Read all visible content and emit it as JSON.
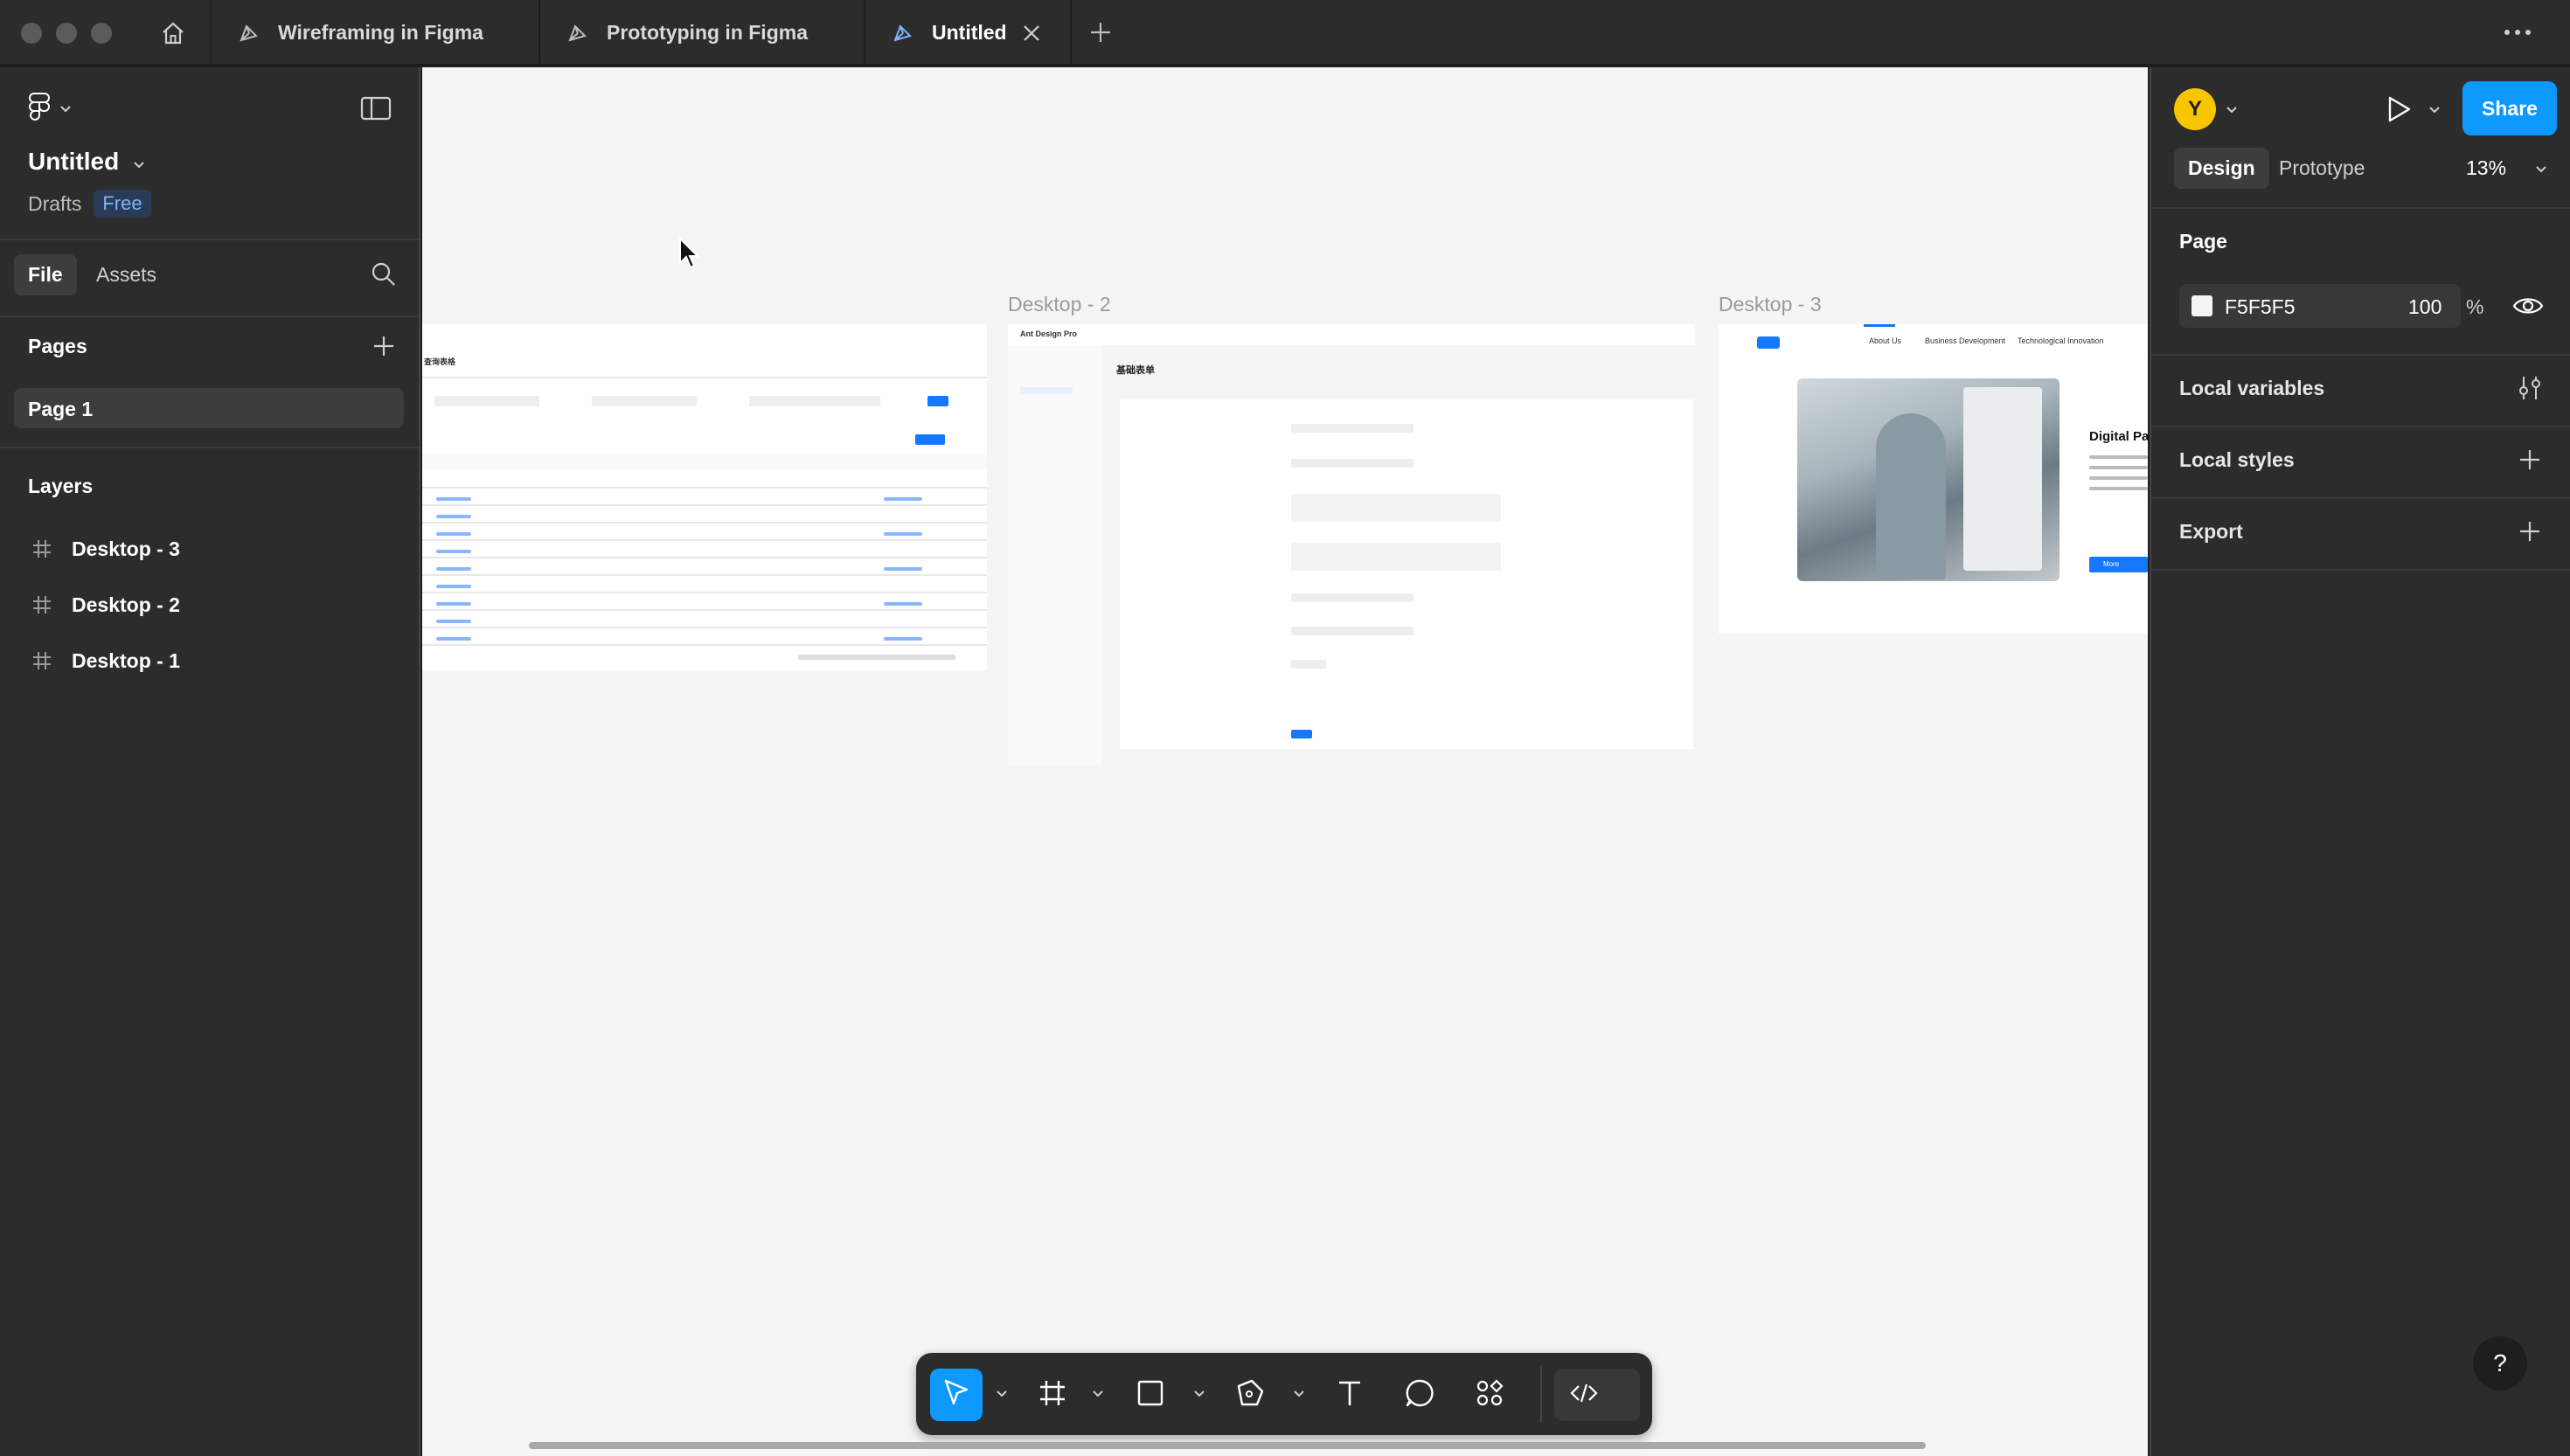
{
  "tabs": [
    {
      "label": "Wireframing in Figma",
      "active": false
    },
    {
      "label": "Prototyping in Figma",
      "active": false
    },
    {
      "label": "Untitled",
      "active": true
    }
  ],
  "file": {
    "name": "Untitled",
    "location": "Drafts",
    "plan": "Free"
  },
  "left_tabs": {
    "file": "File",
    "assets": "Assets"
  },
  "pages": {
    "heading": "Pages",
    "items": [
      "Page 1"
    ]
  },
  "layers": {
    "heading": "Layers",
    "items": [
      "Desktop - 3",
      "Desktop - 2",
      "Desktop - 1"
    ]
  },
  "canvas": {
    "frames": [
      {
        "label": "Desktop - 2"
      },
      {
        "label": "Desktop - 3"
      }
    ],
    "frame3_nav": [
      "About Us",
      "Business Development",
      "Technological Innovation"
    ],
    "frame3_heading": "Digital Pa",
    "frame3_button": "More",
    "frame2_brand": "Ant Design Pro",
    "frame2_title": "基础表单",
    "frame1_title": "查询表格"
  },
  "toolbar": {
    "tools": [
      "move-tool",
      "frame-tool",
      "rectangle-tool",
      "pen-tool",
      "text-tool",
      "comment-tool",
      "actions-tool"
    ],
    "dev_mode": "dev-mode-toggle"
  },
  "right": {
    "avatar": "Y",
    "share": "Share",
    "tab_design": "Design",
    "tab_prototype": "Prototype",
    "zoom": "13%",
    "page_heading": "Page",
    "bg_hex": "F5F5F5",
    "bg_opacity": "100",
    "percent": "%",
    "local_variables": "Local variables",
    "local_styles": "Local styles",
    "export": "Export",
    "help": "?"
  },
  "colors": {
    "accent": "#0d99ff",
    "canvas_bg": "#f5f5f5",
    "panel_bg": "#2c2c2c"
  }
}
